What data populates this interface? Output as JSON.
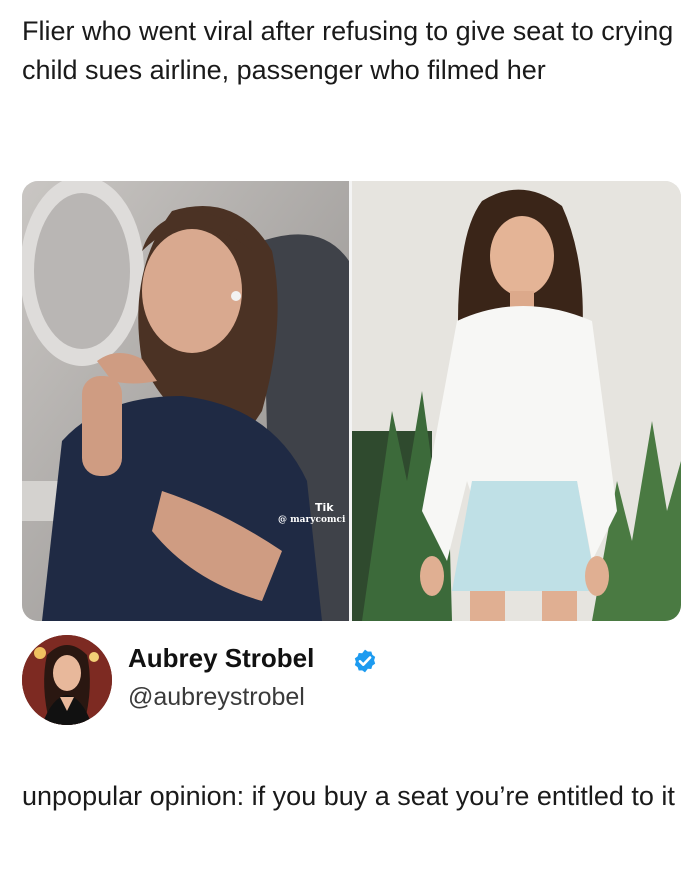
{
  "headline": "Flier who went viral after refusing to give seat to crying child sues airline, passenger who filmed her",
  "media": {
    "left_photo": {
      "description_icon": "airplane-passenger-photo",
      "watermark_app": "Tik",
      "watermark_user": "@ marycomci"
    },
    "right_photo": {
      "description_icon": "portrait-photo"
    }
  },
  "tweet": {
    "author_name": "Aubrey Strobel",
    "author_handle": "@aubreystrobel",
    "verified_icon": "verified-badge-icon",
    "verified_color": "#1d9bf0",
    "text": "unpopular opinion: if you buy a seat you’re entitled to it"
  }
}
